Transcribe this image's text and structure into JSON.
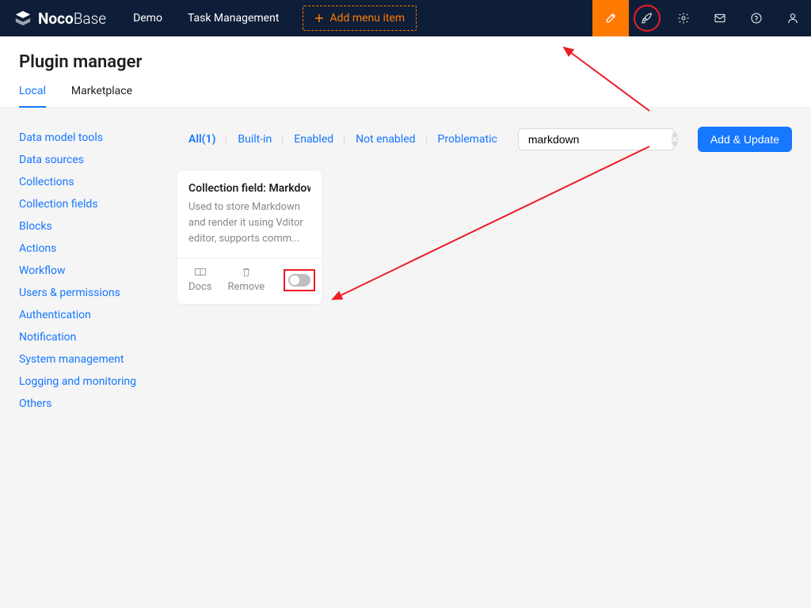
{
  "brand": {
    "bold": "Noco",
    "light": "Base"
  },
  "nav": {
    "items": [
      "Demo",
      "Task Management"
    ],
    "add": "Add menu item"
  },
  "page": {
    "title": "Plugin manager"
  },
  "tabs": {
    "local": "Local",
    "marketplace": "Marketplace"
  },
  "sidebar": {
    "items": [
      "Data model tools",
      "Data sources",
      "Collections",
      "Collection fields",
      "Blocks",
      "Actions",
      "Workflow",
      "Users & permissions",
      "Authentication",
      "Notification",
      "System management",
      "Logging and monitoring",
      "Others"
    ]
  },
  "filters": {
    "all": "All(1)",
    "builtin": "Built-in",
    "enabled": "Enabled",
    "notenabled": "Not enabled",
    "problematic": "Problematic"
  },
  "search": {
    "value": "markdown"
  },
  "actions": {
    "addUpdate": "Add & Update"
  },
  "plugin": {
    "title": "Collection field: Markdow",
    "desc": "Used to store Markdown and render it using Vditor editor, supports comm...",
    "docs": "Docs",
    "remove": "Remove"
  }
}
